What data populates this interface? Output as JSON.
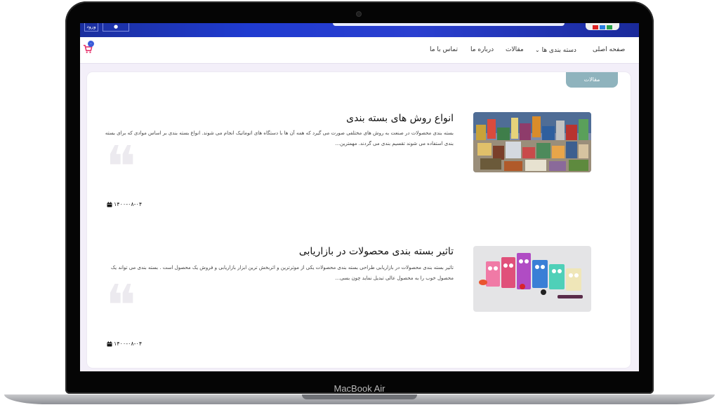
{
  "device": {
    "label": "MacBook Air"
  },
  "topbar": {
    "left_icon_label": "ورود"
  },
  "nav": {
    "items": [
      {
        "label": "صفحه اصلی"
      },
      {
        "label": "دسته بندی ها"
      },
      {
        "label": "مقالات"
      },
      {
        "label": "درباره ما"
      },
      {
        "label": "تماس با ما"
      }
    ],
    "cart_count": "۰"
  },
  "category_tab": "مقالات",
  "posts": [
    {
      "title": "انواع روش های بسته بندی",
      "excerpt": "بسته بندی محصولات در صنعت به روش های مختلفی صورت می گیرد که همه آن ها با دستگاه های اتوماتیک انجام می شوند. انواع بسته بندی بر اساس موادی که برای بسته بندی استفاده می شوند تقسیم بندی می گردند. مهمترین...",
      "date": "۱۴۰۰-۰۸-۰۴"
    },
    {
      "title": "تاثیر بسته بندی محصولات در بازاریابی",
      "excerpt": "تاثیر بسته بندی محصولات در بازاریابی طراحی بسته بندی محصولات یکی از موثرترین و اثربخش ترین ابزار بازاریابی و فروش یک محصول است . بسته بندی می تواند یک محصول خوب را به محصول عالی تبدیل نماید چون بسی...",
      "date": "۱۴۰۰-۰۸-۰۴"
    }
  ],
  "colors": {
    "topbar": "#1f3bd0",
    "accent_tab": "#8fb3bd",
    "cart": "#e5356d",
    "badge": "#3a5bd9"
  }
}
